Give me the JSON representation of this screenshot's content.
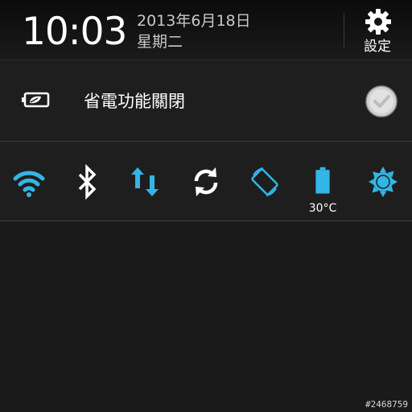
{
  "header": {
    "time": "10:03",
    "date": "2013年6月18日",
    "weekday": "星期二",
    "settings_label": "設定",
    "settings_icon": "gear-icon"
  },
  "power_saver": {
    "label": "省電功能關閉",
    "icon": "battery-leaf-icon",
    "checked": false
  },
  "quick_settings": [
    {
      "name": "wifi",
      "icon": "wifi-icon",
      "active": true,
      "color": "#33b5e5"
    },
    {
      "name": "bluetooth",
      "icon": "bluetooth-icon",
      "active": false,
      "color": "#ffffff"
    },
    {
      "name": "mobile-data",
      "icon": "data-arrows-icon",
      "active": true,
      "color": "#33b5e5"
    },
    {
      "name": "sync",
      "icon": "sync-icon",
      "active": false,
      "color": "#ffffff"
    },
    {
      "name": "auto-rotate",
      "icon": "rotate-icon",
      "active": true,
      "color": "#33b5e5"
    },
    {
      "name": "battery",
      "icon": "battery-icon",
      "active": true,
      "color": "#33b5e5",
      "temperature": "30°C"
    },
    {
      "name": "brightness",
      "icon": "brightness-icon",
      "active": true,
      "color": "#33b5e5"
    }
  ],
  "watermark": "#2468759",
  "colors": {
    "accent": "#33b5e5",
    "background": "#1a1a1a",
    "divider": "#3b3b3b"
  }
}
